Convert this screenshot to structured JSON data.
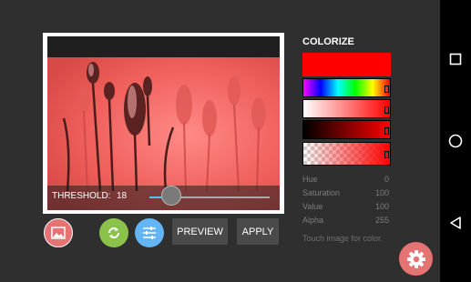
{
  "panel": {
    "title": "COLORIZE",
    "selected_color": "#ff0000",
    "hint": "Touch image for color.",
    "values": [
      {
        "label": "Hue",
        "value": "0"
      },
      {
        "label": "Saturation",
        "value": "100"
      },
      {
        "label": "Value",
        "value": "100"
      },
      {
        "label": "Alpha",
        "value": "255"
      }
    ]
  },
  "image": {
    "threshold_label": "THRESHOLD:",
    "threshold_value": "18",
    "threshold_fraction": 0.18,
    "tint": "#ef5350"
  },
  "toolbar": {
    "preview_label": "PREVIEW",
    "apply_label": "APPLY",
    "colors": {
      "image_button": "#e57373",
      "refresh_button": "#8bc34a",
      "adjust_button": "#64b5f6"
    }
  }
}
